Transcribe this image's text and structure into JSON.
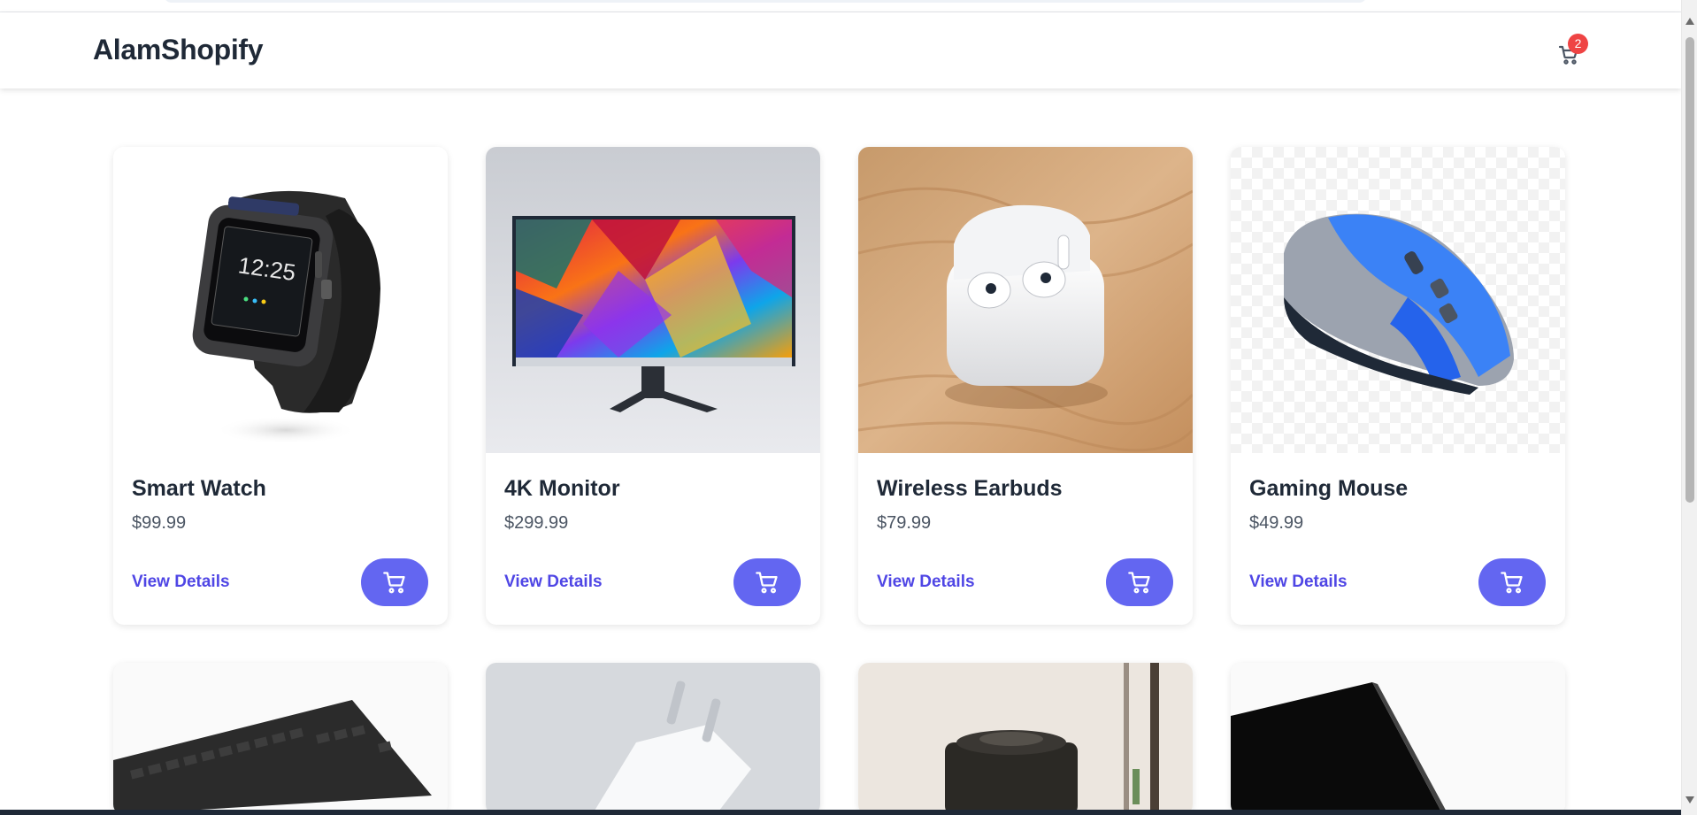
{
  "store": {
    "brand": "AlamShopify",
    "cart_count": "2",
    "accent_color": "#6366f1",
    "badge_color": "#ef4444"
  },
  "products": [
    {
      "name": "Smart Watch",
      "price": "$99.99",
      "details_label": "View Details",
      "cart_icon": "cart-icon",
      "image": "smart-watch-image"
    },
    {
      "name": "4K Monitor",
      "price": "$299.99",
      "details_label": "View Details",
      "cart_icon": "cart-icon",
      "image": "monitor-image"
    },
    {
      "name": "Wireless Earbuds",
      "price": "$79.99",
      "details_label": "View Details",
      "cart_icon": "cart-icon",
      "image": "earbuds-image"
    },
    {
      "name": "Gaming Mouse",
      "price": "$49.99",
      "details_label": "View Details",
      "cart_icon": "cart-icon",
      "image": "mouse-image"
    }
  ],
  "partial_products": [
    {
      "image": "keyboard-image"
    },
    {
      "image": "charger-image"
    },
    {
      "image": "speaker-image"
    },
    {
      "image": "laptop-image"
    }
  ]
}
